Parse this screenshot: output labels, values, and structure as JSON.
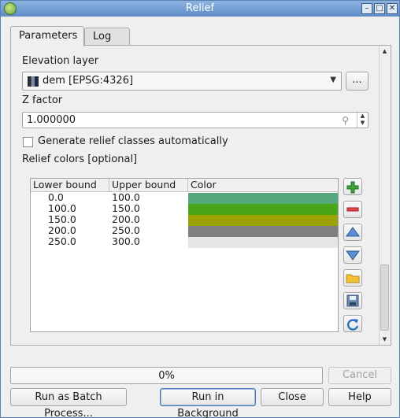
{
  "window": {
    "title": "Relief",
    "controls": [
      "–",
      "□",
      "✕"
    ]
  },
  "tabs": [
    {
      "label": "Parameters",
      "active": true
    },
    {
      "label": "Log",
      "active": false
    }
  ],
  "params": {
    "elevation_label": "Elevation layer",
    "elevation_value": "dem [EPSG:4326]",
    "browse_label": "...",
    "zfactor_label": "Z factor",
    "zfactor_value": "1.000000",
    "auto_classes_label": "Generate relief classes automatically",
    "auto_classes_checked": false,
    "relief_colors_label": "Relief colors [optional]"
  },
  "table": {
    "headers": [
      "Lower bound",
      "Upper bound",
      "Color"
    ],
    "rows": [
      {
        "lower": "0.0",
        "upper": "100.0",
        "color": "#55a87c"
      },
      {
        "lower": "100.0",
        "upper": "150.0",
        "color": "#4aa517"
      },
      {
        "lower": "150.0",
        "upper": "200.0",
        "color": "#9ca203"
      },
      {
        "lower": "200.0",
        "upper": "250.0",
        "color": "#7f7f7f"
      },
      {
        "lower": "250.0",
        "upper": "300.0",
        "color": "#e6e6e6"
      }
    ]
  },
  "side_buttons": [
    "add-icon",
    "remove-icon",
    "move-up-icon",
    "move-down-icon",
    "open-folder-icon",
    "save-icon",
    "refresh-icon"
  ],
  "progress": {
    "value": 0,
    "text": "0%"
  },
  "buttons": {
    "cancel": "Cancel",
    "batch": "Run as Batch Process...",
    "background": "Run in Background",
    "close": "Close",
    "help": "Help"
  }
}
